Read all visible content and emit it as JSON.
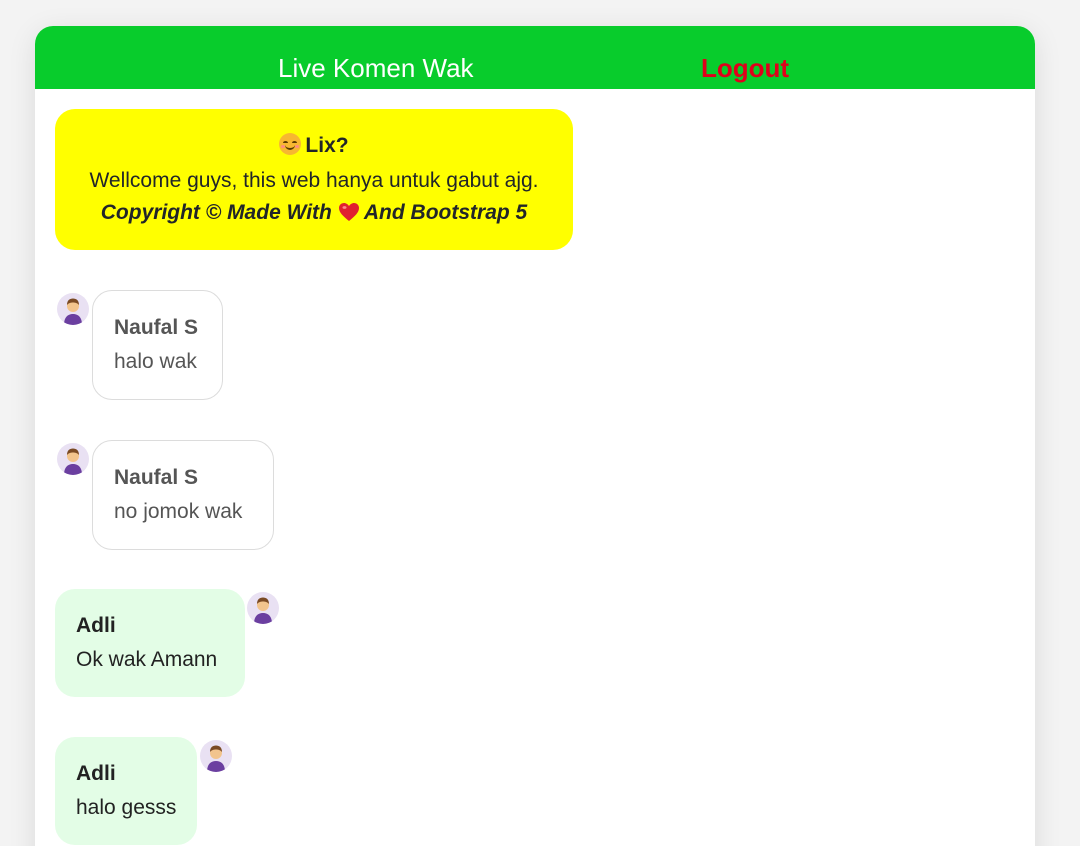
{
  "header": {
    "title": "Live Komen Wak",
    "logout_label": "Logout"
  },
  "welcome": {
    "title": "Lix?",
    "title_icon": "smiling-face-icon",
    "body": "Wellcome guys, this web hanya untuk gabut ajg.",
    "copyright_prefix": "Copyright © Made With",
    "copyright_icon": "heart-icon",
    "copyright_suffix": "And Bootstrap 5"
  },
  "messages": [
    {
      "name": "Naufal S",
      "text": "halo wak",
      "side": "left",
      "avatar": "user-avatar-icon"
    },
    {
      "name": "Naufal S",
      "text": "no jomok wak",
      "side": "left",
      "avatar": "user-avatar-icon"
    },
    {
      "name": "Adli",
      "text": "Ok wak Amann",
      "side": "right",
      "avatar": "user-avatar-icon"
    },
    {
      "name": "Adli",
      "text": "halo gesss",
      "side": "right",
      "avatar": "user-avatar-icon"
    }
  ],
  "colors": {
    "header_bg": "#08cc2c",
    "logout_text": "#e0001b",
    "welcome_bg": "#ffff00",
    "own_bubble_bg": "#e3fde6",
    "other_bubble_bg": "#ffffff",
    "heart": "#e0202f"
  }
}
